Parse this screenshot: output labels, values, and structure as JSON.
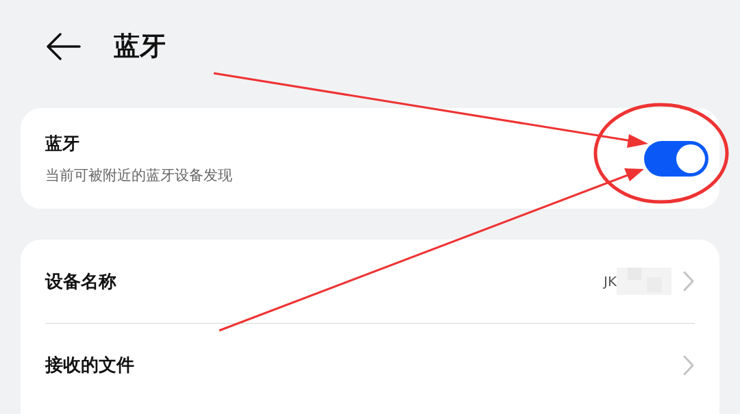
{
  "header": {
    "title": "蓝牙"
  },
  "bluetooth": {
    "title": "蓝牙",
    "subtitle": "当前可被附近的蓝牙设备发现",
    "on": true
  },
  "items": [
    {
      "label": "设备名称",
      "value": "JK",
      "redacted": true
    },
    {
      "label": "接收的文件"
    }
  ]
}
